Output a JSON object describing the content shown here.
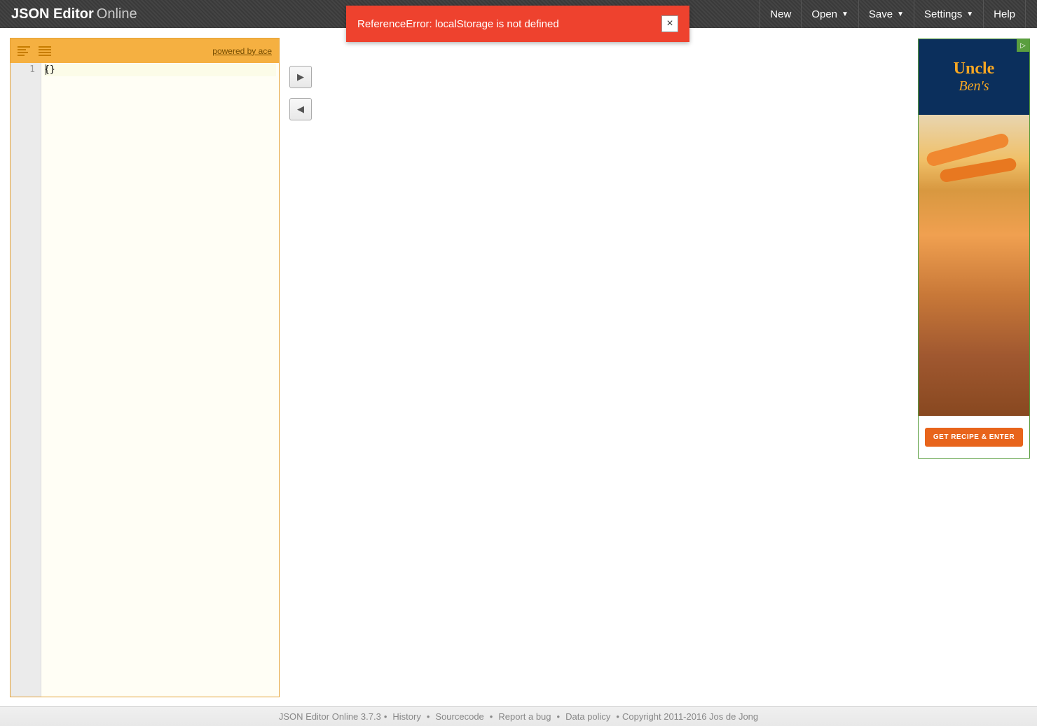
{
  "header": {
    "logo_bold": "JSON Editor",
    "logo_light": "Online",
    "menu": {
      "new": "New",
      "open": "Open",
      "save": "Save",
      "settings": "Settings",
      "help": "Help"
    }
  },
  "notification": {
    "message": "ReferenceError: localStorage is not defined",
    "close": "×"
  },
  "editor": {
    "powered_by": "powered by ace",
    "line_numbers": [
      "1"
    ],
    "content": "{}"
  },
  "transfer": {
    "right": "▶",
    "left": "◀"
  },
  "ad": {
    "marker": "▷",
    "brand": "Uncle",
    "brand_sub": "Ben's",
    "cta": "GET RECIPE & ENTER"
  },
  "footer": {
    "product": "JSON Editor Online 3.7.3",
    "history": "History",
    "sourcecode": "Sourcecode",
    "report_bug": "Report a bug",
    "data_policy": "Data policy",
    "copyright": "Copyright 2011-2016 Jos de Jong"
  }
}
